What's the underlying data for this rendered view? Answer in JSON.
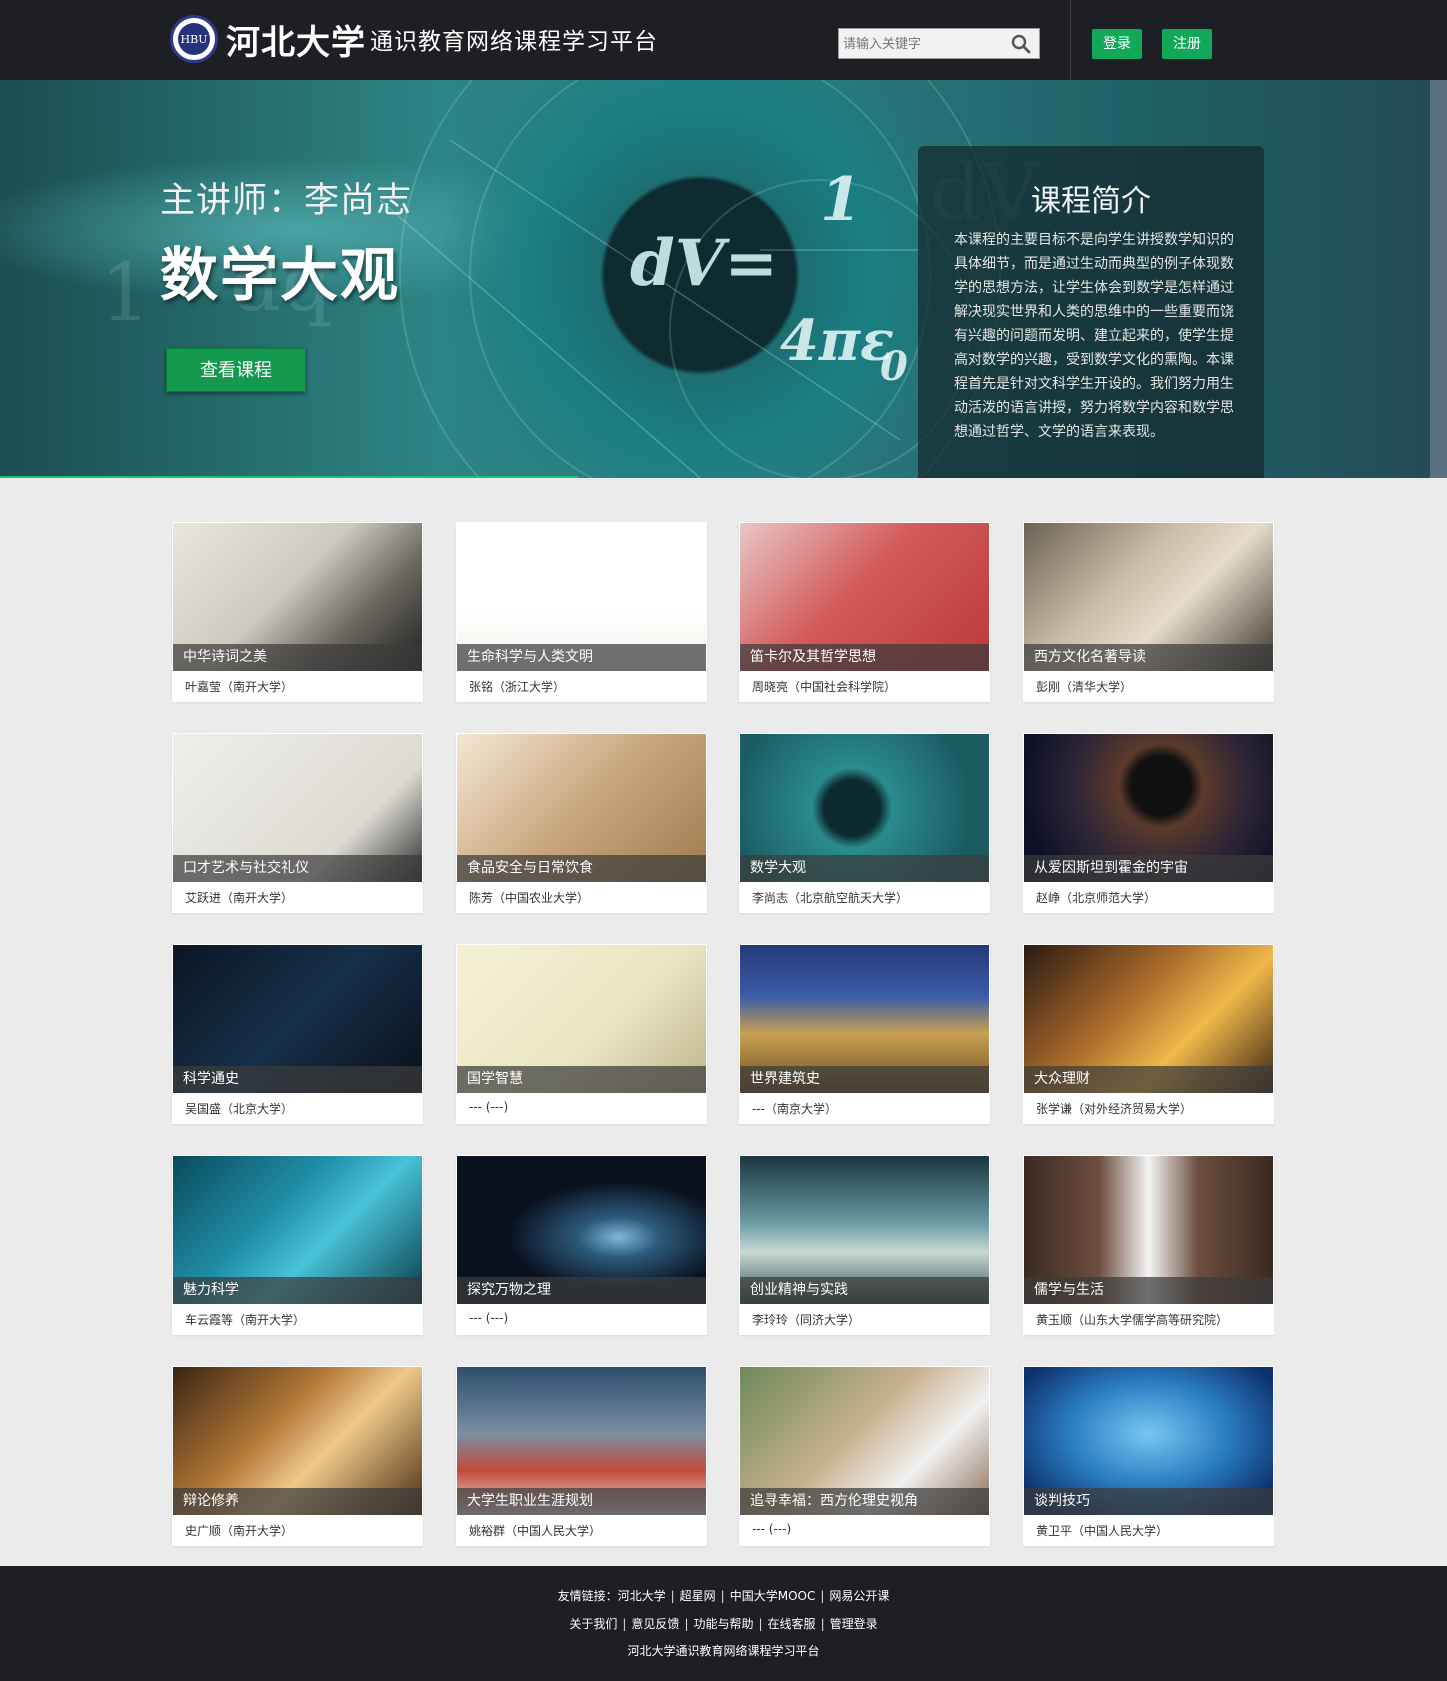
{
  "header": {
    "university_name": "河北大学",
    "platform_name": "通识教育网络课程学习平台",
    "emblem_text": "HBU",
    "search_placeholder": "请输入关键字",
    "login_label": "登录",
    "register_label": "注册"
  },
  "banner": {
    "teacher_line": "主讲师：李尚志",
    "course_title": "数学大观",
    "view_button": "查看课程",
    "intro_heading": "课程简介",
    "intro_text": "本课程的主要目标不是向学生讲授数学知识的具体细节，而是通过生动而典型的例子体现数学的思想方法，让学生体会到数学是怎样通过解决现实世界和人类的思维中的一些重要而饶有兴趣的问题而发明、建立起来的，使学生提高对数学的兴趣，受到数学文化的熏陶。本课程首先是针对文科学生开设的。我们努力用生动活泼的语言讲授，努力将数学内容和数学思想通过哲学、文学的语言来表现。"
  },
  "courses": [
    {
      "title": "中华诗词之美",
      "teacher": "叶嘉莹（南开大学）",
      "theme": "ink"
    },
    {
      "title": "生命科学与人类文明",
      "teacher": "张铭（浙江大学）",
      "theme": "evolution"
    },
    {
      "title": "笛卡尔及其哲学思想",
      "teacher": "周晓亮（中国社会科学院）",
      "theme": "stamp"
    },
    {
      "title": "西方文化名著导读",
      "teacher": "彭刚（清华大学）",
      "theme": "book"
    },
    {
      "title": "口才艺术与社交礼仪",
      "teacher": "艾跃进（南开大学）",
      "theme": "paper"
    },
    {
      "title": "食品安全与日常饮食",
      "teacher": "陈芳（中国农业大学）",
      "theme": "food"
    },
    {
      "title": "数学大观",
      "teacher": "李尚志（北京航空航天大学）",
      "theme": "math"
    },
    {
      "title": "从爱因斯坦到霍金的宇宙",
      "teacher": "赵峥（北京师范大学）",
      "theme": "space"
    },
    {
      "title": "科学通史",
      "teacher": "吴国盛（北京大学）",
      "theme": "worldmap"
    },
    {
      "title": "国学智慧",
      "teacher": "--- (---)",
      "theme": "guoxue"
    },
    {
      "title": "世界建筑史",
      "teacher": "---（南京大学）",
      "theme": "temple"
    },
    {
      "title": "大众理财",
      "teacher": "张学谦（对外经济贸易大学）",
      "theme": "coins"
    },
    {
      "title": "魅力科学",
      "teacher": "车云霞等（南开大学）",
      "theme": "science"
    },
    {
      "title": "探究万物之理",
      "teacher": "--- (---)",
      "theme": "cosmos"
    },
    {
      "title": "创业精神与实践",
      "teacher": "李玲玲（同济大学）",
      "theme": "bottle"
    },
    {
      "title": "儒学与生活",
      "teacher": "黄玉顺（山东大学儒学高等研究院）",
      "theme": "tea"
    },
    {
      "title": "辩论修养",
      "teacher": "史广顺（南开大学）",
      "theme": "handshake"
    },
    {
      "title": "大学生职业生涯规划",
      "teacher": "姚裕群（中国人民大学）",
      "theme": "runner"
    },
    {
      "title": "追寻幸福：西方伦理史视角",
      "teacher": "--- (---)",
      "theme": "happy"
    },
    {
      "title": "谈判技巧",
      "teacher": "黄卫平（中国人民大学）",
      "theme": "business"
    }
  ],
  "footer": {
    "links_label": "友情链接：",
    "links": [
      "河北大学",
      "超星网",
      "中国大学MOOC",
      "网易公开课"
    ],
    "nav": [
      "关于我们",
      "意见反馈",
      "功能与帮助",
      "在线客服",
      "管理登录"
    ],
    "copyright": "河北大学通识教育网络课程学习平台"
  }
}
